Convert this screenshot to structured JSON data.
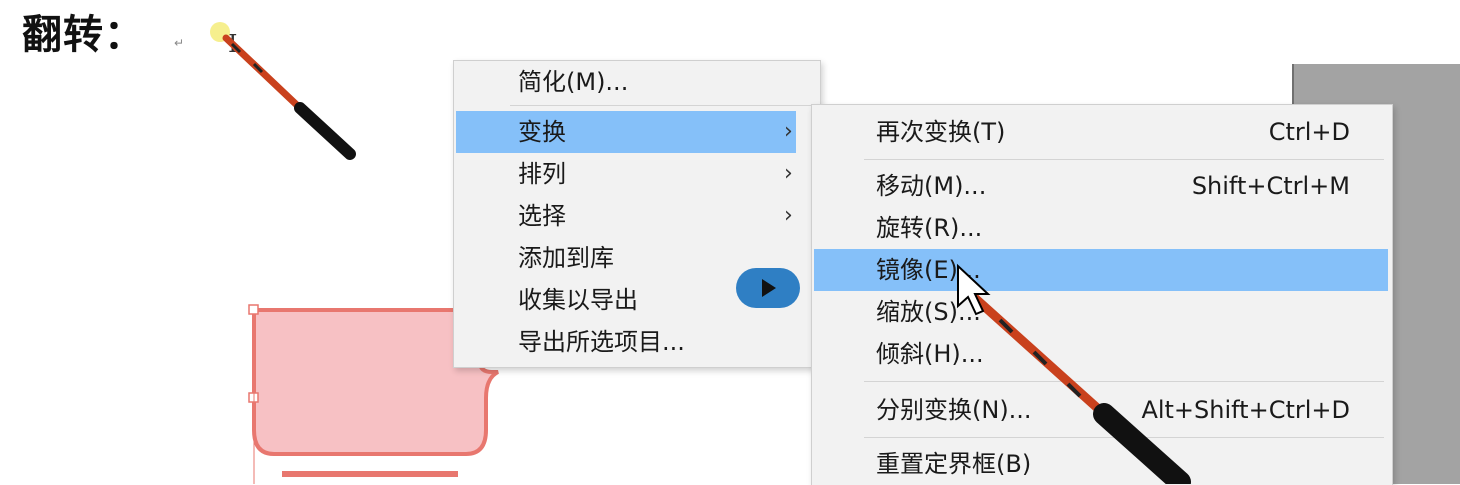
{
  "heading": {
    "title": "翻转：",
    "return_mark": "↵",
    "cursor": "I"
  },
  "context_menu": {
    "items": [
      {
        "label": "简化(M)...",
        "has_submenu": false
      },
      {
        "label": "变换",
        "has_submenu": true,
        "active": true
      },
      {
        "label": "排列",
        "has_submenu": true
      },
      {
        "label": "选择",
        "has_submenu": true
      },
      {
        "label": "添加到库",
        "has_submenu": false
      },
      {
        "label": "收集以导出",
        "has_submenu": false
      },
      {
        "label": "导出所选项目...",
        "has_submenu": false
      }
    ],
    "submenu_arrow": "›"
  },
  "transform_submenu": {
    "items": [
      {
        "label": "再次变换(T)",
        "shortcut": "Ctrl+D"
      },
      {
        "label": "移动(M)...",
        "shortcut": "Shift+Ctrl+M"
      },
      {
        "label": "旋转(R)...",
        "shortcut": ""
      },
      {
        "label": "镜像(E)...",
        "shortcut": "",
        "active": true
      },
      {
        "label": "缩放(S)...",
        "shortcut": ""
      },
      {
        "label": "倾斜(H)...",
        "shortcut": ""
      },
      {
        "label": "分别变换(N)...",
        "shortcut": "Alt+Shift+Ctrl+D"
      },
      {
        "label": "重置定界框(B)",
        "shortcut": ""
      }
    ]
  },
  "colors": {
    "highlight": "#85c0f9",
    "menu_bg": "#f2f2f2",
    "shape_fill": "#f7c1c4",
    "shape_stroke": "#e8776f",
    "play_button": "#2f7fc4",
    "canvas_gray": "#a3a3a3"
  },
  "icons": {
    "play": "play-icon",
    "pointer": "mouse-pointer-icon",
    "stick": "pointer-stick-icon"
  }
}
